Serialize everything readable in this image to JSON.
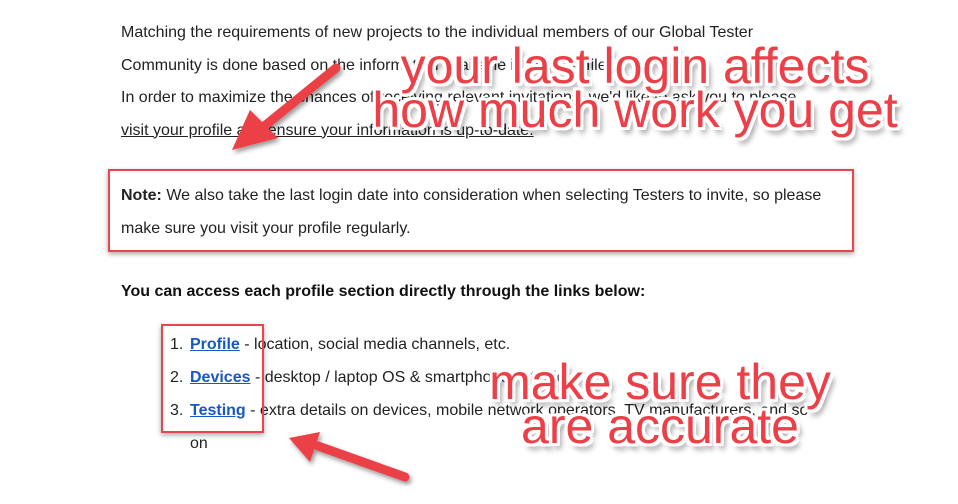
{
  "intro": {
    "line1": "Matching the requirements of new projects to the individual members of our Global Tester",
    "line2": "Community is done based on the information available in your profile.",
    "line3_prefix": "In order to maximize the chances of receiving relevant invitations, we'd like to ask you to ",
    "line3_link": "please",
    "line4_link": "visit your profile and ensure your information is up-to-date."
  },
  "note": {
    "label": "Note:",
    "text": " We also take the last login date into consideration when selecting Testers to invite, so please make sure you visit your profile regularly."
  },
  "section_heading": "You can access each profile section directly through the links below:",
  "links": [
    {
      "num": "1.",
      "label": "Profile",
      "desc": " - location, social media channels, etc."
    },
    {
      "num": "2.",
      "label": "Devices",
      "desc": " - desktop / laptop OS & smartphones / tablets"
    },
    {
      "num": "3.",
      "label": "Testing",
      "desc": " - extra details on devices, mobile network operators, TV manufacturers, and so",
      "desc_cont": "on"
    }
  ],
  "annotations": {
    "top_line1": "your last login affects",
    "top_line2": "how much work you get",
    "bottom_line1": "make sure they",
    "bottom_line2": "are accurate"
  },
  "colors": {
    "annotation_red": "#ec3f47",
    "link_blue": "#1a56c4"
  }
}
